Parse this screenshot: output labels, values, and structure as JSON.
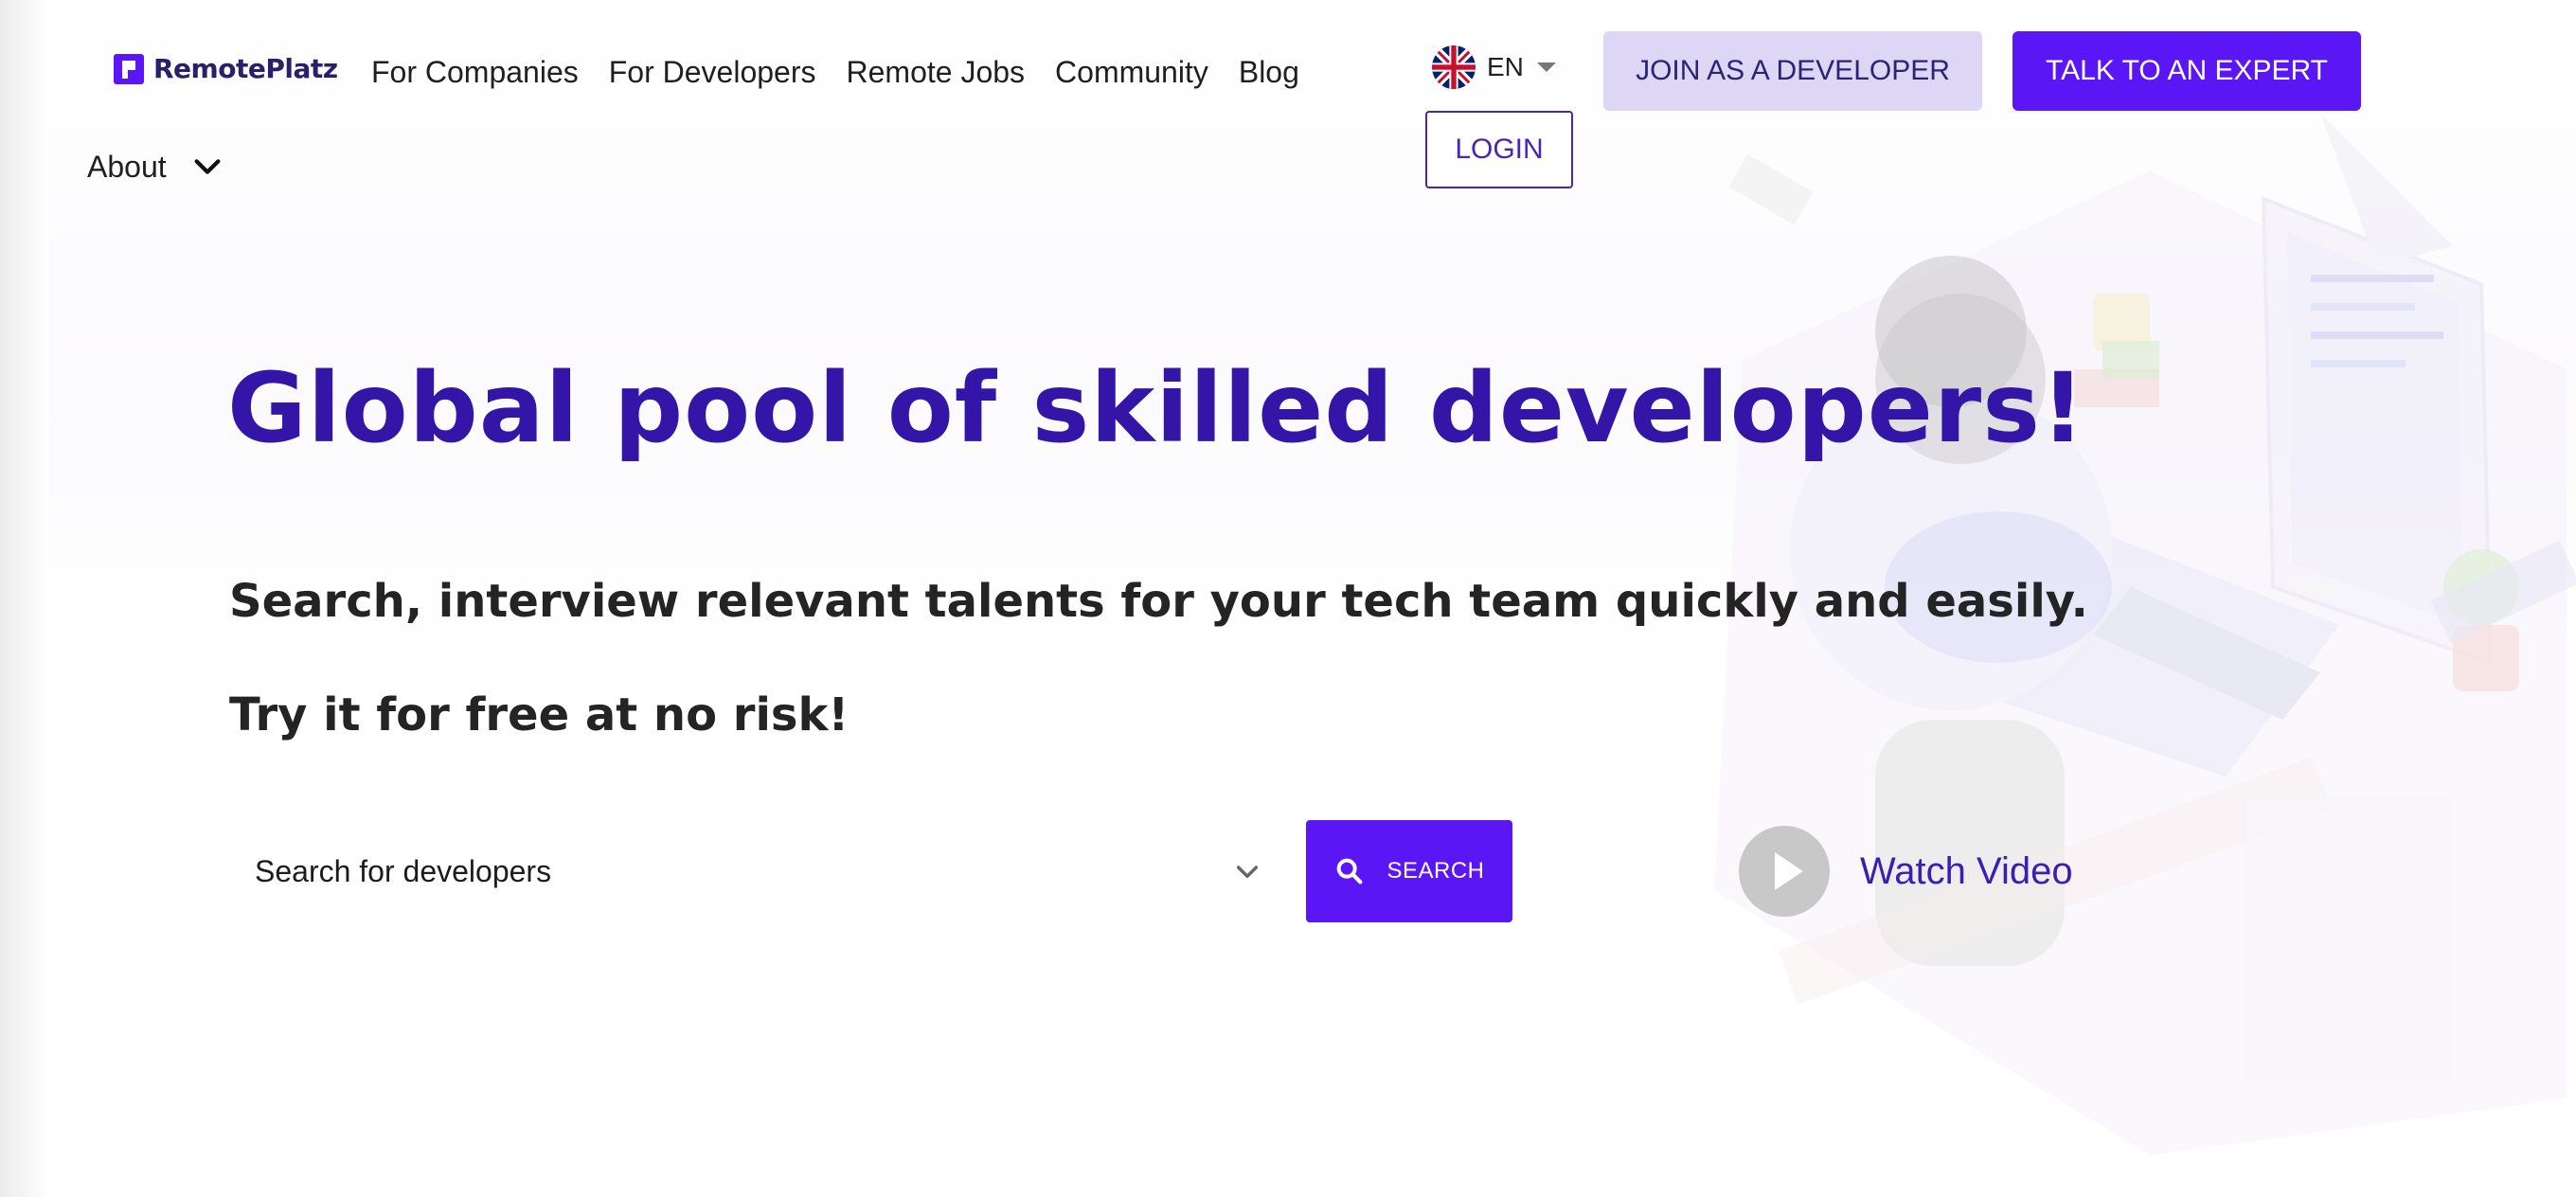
{
  "brand": {
    "name": "RemotePlatz",
    "accent": "#5a16f5",
    "accent_light": "#ddd6f5",
    "heading_color": "#3316a8"
  },
  "nav": {
    "links": [
      "For Companies",
      "For Developers",
      "Remote Jobs",
      "Community",
      "Blog"
    ],
    "about": "About",
    "language": {
      "code": "EN",
      "flag_icon": "uk-flag-icon"
    },
    "join_label": "JOIN AS A DEVELOPER",
    "talk_label": "TALK TO AN EXPERT",
    "login_label": "LOGIN"
  },
  "hero": {
    "title": "Global pool of skilled developers!",
    "subtitle": "Search, interview relevant talents for your tech team quickly and easily.",
    "subtitle2": "Try it for free at no risk!"
  },
  "search": {
    "placeholder": "Search for developers",
    "button_label": "SEARCH"
  },
  "video": {
    "label": "Watch Video"
  }
}
